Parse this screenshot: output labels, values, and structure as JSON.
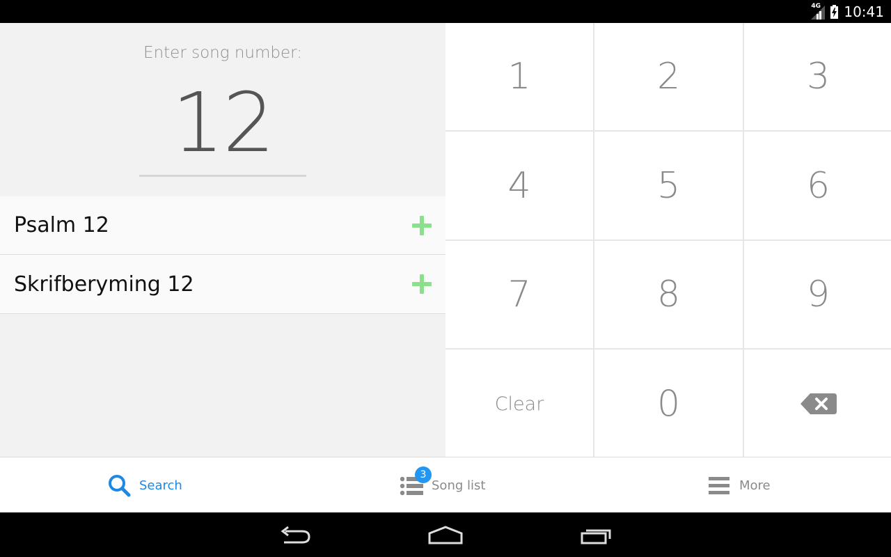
{
  "status_bar": {
    "network": "4G",
    "time": "10:41"
  },
  "search": {
    "prompt": "Enter song number:",
    "value": "12"
  },
  "results": [
    {
      "title": "Psalm 12"
    },
    {
      "title": "Skrifberyming 12"
    }
  ],
  "keypad": {
    "keys": [
      "1",
      "2",
      "3",
      "4",
      "5",
      "6",
      "7",
      "8",
      "9"
    ],
    "clear_label": "Clear",
    "zero": "0"
  },
  "bottom_nav": {
    "search_label": "Search",
    "songlist_label": "Song list",
    "songlist_badge": "3",
    "more_label": "More"
  },
  "colors": {
    "accent": "#1e88e5",
    "badge": "#2196f3",
    "add": "#8be08b"
  }
}
